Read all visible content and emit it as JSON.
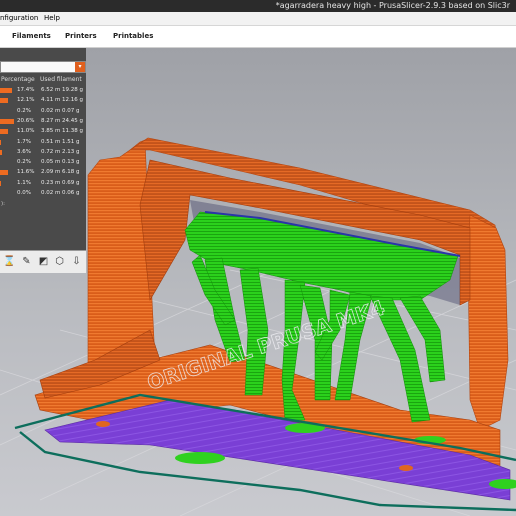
{
  "window": {
    "title": "*agarradera heavy high - PrusaSlicer-2.9.3 based on Slic3r"
  },
  "menu": {
    "items": [
      "nfiguration",
      "Help"
    ]
  },
  "tabs": [
    "Filaments",
    "Printers",
    "Printables"
  ],
  "legend": {
    "columns": [
      "Percentage",
      "Used filament"
    ],
    "rows": [
      {
        "pct": "17.4%",
        "m": "6.52 m",
        "g": "19.28 g",
        "fill": 0.6
      },
      {
        "pct": "12.1%",
        "m": "4.11 m",
        "g": "12.16 g",
        "fill": 0.42
      },
      {
        "pct": "0.2%",
        "m": "0.02 m",
        "g": "0.07 g",
        "fill": 0.01
      },
      {
        "pct": "20.6%",
        "m": "8.27 m",
        "g": "24.45 g",
        "fill": 0.7
      },
      {
        "pct": "11.0%",
        "m": "3.85 m",
        "g": "11.38 g",
        "fill": 0.38
      },
      {
        "pct": "1.7%",
        "m": "0.51 m",
        "g": "1.51 g",
        "fill": 0.05
      },
      {
        "pct": "3.6%",
        "m": "0.72 m",
        "g": "2.13 g",
        "fill": 0.12
      },
      {
        "pct": "0.2%",
        "m": "0.05 m",
        "g": "0.13 g",
        "fill": 0.01
      },
      {
        "pct": "11.6%",
        "m": "2.09 m",
        "g": "6.18 g",
        "fill": 0.4
      },
      {
        "pct": "1.1%",
        "m": "0.23 m",
        "g": "0.69 g",
        "fill": 0.04
      },
      {
        "pct": "0.0%",
        "m": "0.02 m",
        "g": "0.06 g",
        "fill": 0.0
      }
    ],
    "footer": "):"
  },
  "bed_text": "ORIGINAL PRUSA MK4",
  "colors": {
    "accent": "#ed6b21",
    "perimeter": "#e0661f",
    "support": "#2fd11f",
    "first_layer": "#7b3dd6",
    "outline": "#0d6e5c"
  },
  "toolbar_icons": [
    "hourglass-icon",
    "pencil-icon",
    "checker-icon",
    "cube-icon",
    "export-icon"
  ]
}
